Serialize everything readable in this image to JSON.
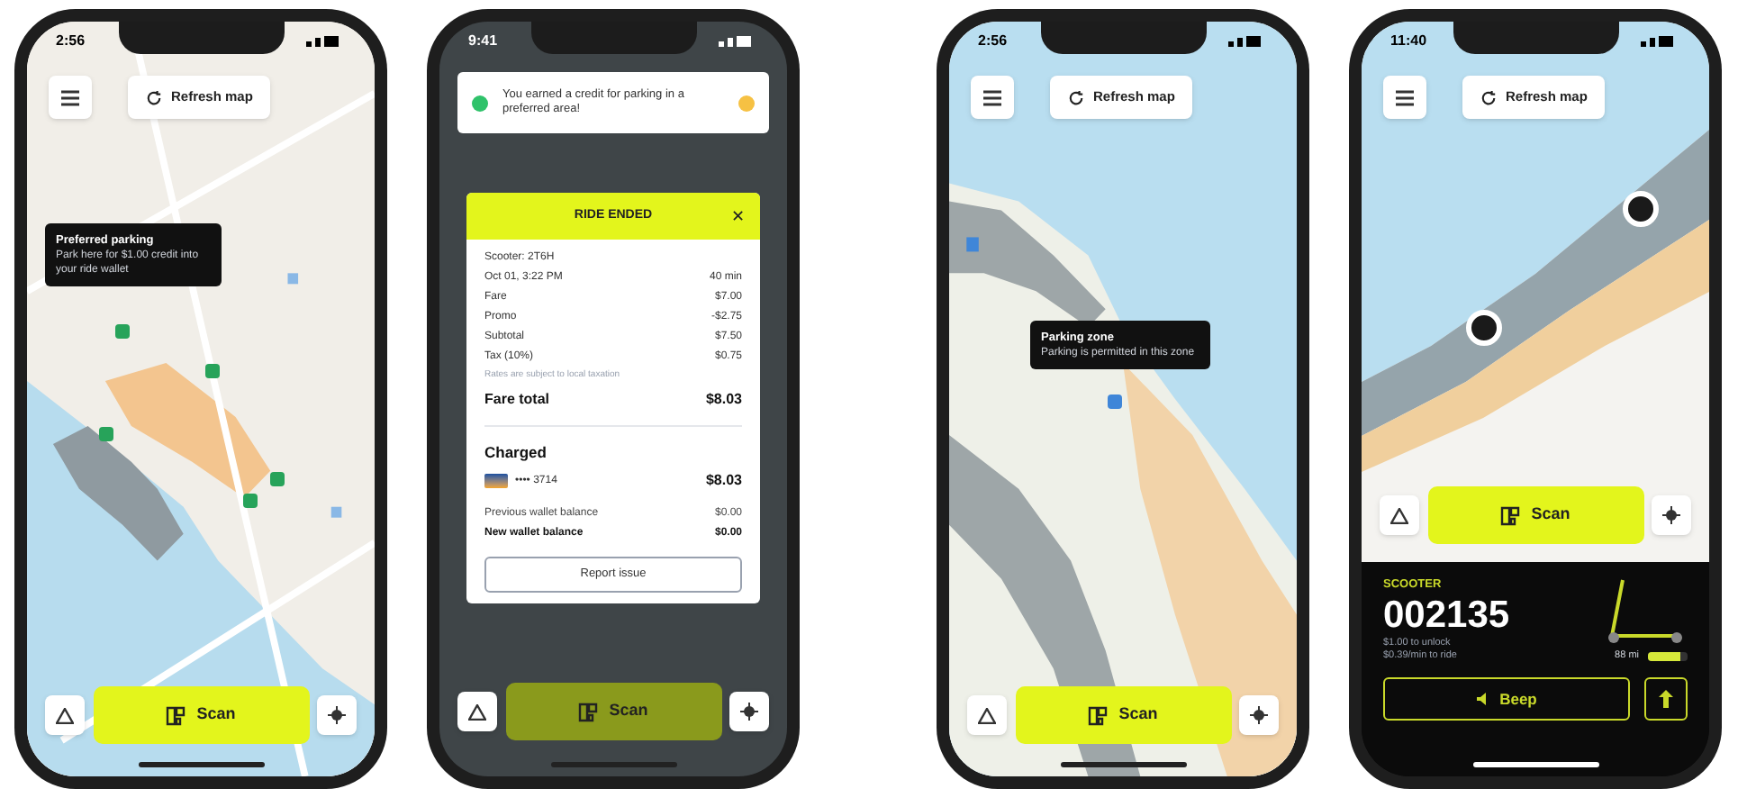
{
  "phones": [
    {
      "kind": "map",
      "status_time": "2:56",
      "refresh_label": "Refresh map",
      "scan_label": "Scan",
      "tooltip": {
        "title": "Preferred parking",
        "body": "Park here for $1.00 credit into your ride wallet"
      }
    },
    {
      "kind": "receipt",
      "status_time": "9:41",
      "scan_label": "Scan",
      "notice": "You earned a credit for parking in a preferred area!",
      "receipt": {
        "title": "RIDE ENDED",
        "close": "✕",
        "rows": [
          {
            "kind": "line",
            "label": "Scooter: 2T6H",
            "value": ""
          },
          {
            "kind": "line",
            "label": "Oct 01, 3:22 PM",
            "value": "40 min"
          },
          {
            "kind": "line",
            "label": "Fare",
            "value": "$7.00"
          },
          {
            "kind": "line",
            "label": "Promo",
            "value": "-$2.75"
          },
          {
            "kind": "line",
            "label": "Subtotal",
            "value": "$7.50"
          },
          {
            "kind": "line",
            "label": "Tax (10%)",
            "value": "$0.75"
          },
          {
            "kind": "note",
            "label": "Rates are subject to local taxation",
            "value": ""
          },
          {
            "kind": "total",
            "label": "Fare total",
            "value": "$8.03"
          }
        ],
        "charged_title": "Charged",
        "card_number": "•••• 3714",
        "charged_amount": "$8.03",
        "balances": [
          {
            "label": "Previous wallet balance",
            "value": "$0.00",
            "bold": false
          },
          {
            "label": "New wallet balance",
            "value": "$0.00",
            "bold": true
          }
        ],
        "report_label": "Report issue"
      }
    },
    {
      "kind": "map",
      "status_time": "2:56",
      "refresh_label": "Refresh map",
      "scan_label": "Scan",
      "tooltip": {
        "title": "Parking zone",
        "body": "Parking is permitted in this zone"
      }
    },
    {
      "kind": "scooter",
      "status_time": "11:40",
      "refresh_label": "Refresh map",
      "scan_label": "Scan",
      "scooter": {
        "caption": "SCOOTER",
        "number": "002135",
        "prices": [
          "$1.00 to unlock",
          "$0.39/min to ride"
        ],
        "range": "88 mi",
        "level": 0.8,
        "beep_label": "Beep"
      }
    }
  ]
}
